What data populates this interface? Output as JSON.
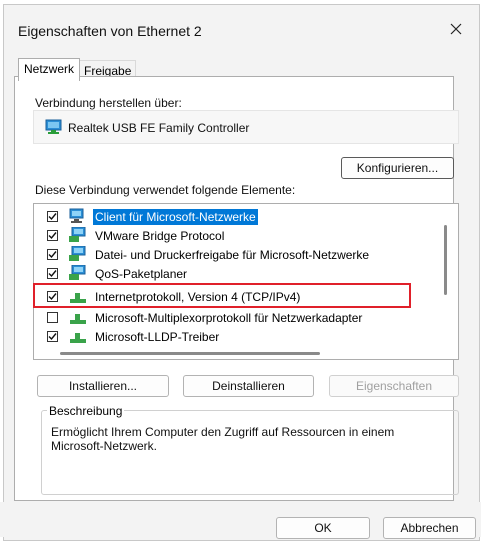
{
  "window": {
    "title": "Eigenschaften von Ethernet 2"
  },
  "tabs": [
    {
      "label": "Netzwerk",
      "active": true
    },
    {
      "label": "Freigabe",
      "active": false
    }
  ],
  "connect_via": {
    "label": "Verbindung herstellen über:",
    "adapter": "Realtek USB FE Family Controller",
    "adapter_icon": "network-adapter-icon"
  },
  "buttons": {
    "configure": "Konfigurieren...",
    "install": "Installieren...",
    "uninstall": "Deinstallieren",
    "properties": "Eigenschaften",
    "ok": "OK",
    "cancel": "Abbrechen"
  },
  "items_label": "Diese Verbindung verwendet folgende Elemente:",
  "items": [
    {
      "label": "Client für Microsoft-Netzwerke",
      "checked": true,
      "icon": "client-icon",
      "selected": true
    },
    {
      "label": "VMware Bridge Protocol",
      "checked": true,
      "icon": "service-icon",
      "selected": false
    },
    {
      "label": "Datei- und Druckerfreigabe für Microsoft-Netzwerke",
      "checked": true,
      "icon": "service-icon",
      "selected": false
    },
    {
      "label": "QoS-Paketplaner",
      "checked": true,
      "icon": "service-icon",
      "selected": false
    },
    {
      "label": "Internetprotokoll, Version 4 (TCP/IPv4)",
      "checked": true,
      "icon": "protocol-icon",
      "selected": false
    },
    {
      "label": "Microsoft-Multiplexorprotokoll für Netzwerkadapter",
      "checked": false,
      "icon": "protocol-icon",
      "selected": false
    },
    {
      "label": "Microsoft-LLDP-Treiber",
      "checked": true,
      "icon": "protocol-icon",
      "selected": false
    }
  ],
  "description": {
    "legend": "Beschreibung",
    "text": "Ermöglicht Ihrem Computer den Zugriff auf Ressourcen in einem Microsoft-Netzwerk."
  },
  "colors": {
    "highlight": "#e0202a",
    "selection": "#0078d7"
  }
}
